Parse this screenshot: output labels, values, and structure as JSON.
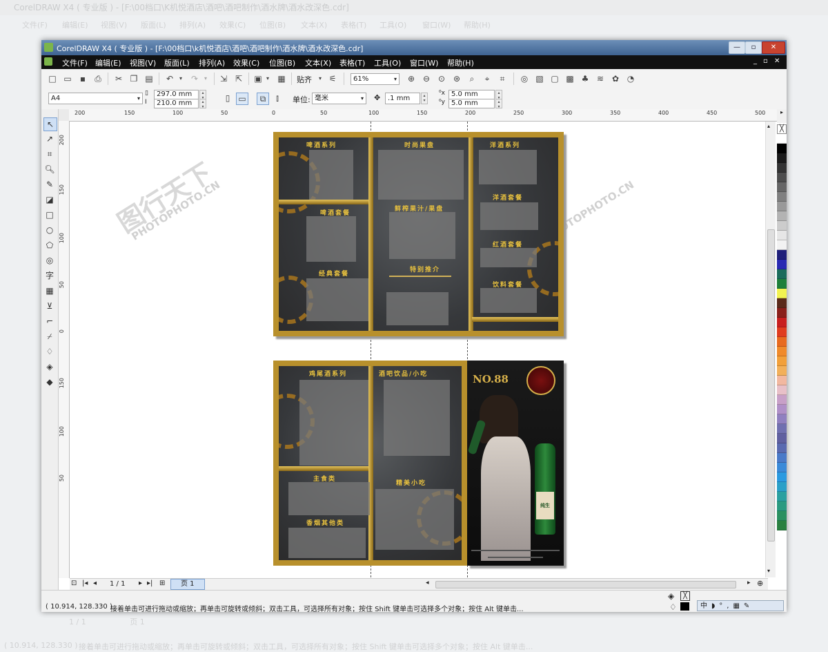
{
  "background": {
    "title": "CorelDRAW X4 ( 专业版 ) - [F:\\00档口\\K机悦酒店\\酒吧\\酒吧制作\\酒水牌\\酒水改深色.cdr]",
    "menus": [
      "文件(F)",
      "编辑(E)",
      "视图(V)",
      "版面(L)",
      "排列(A)",
      "效果(C)",
      "位图(B)",
      "文本(X)",
      "表格(T)",
      "工具(O)",
      "窗口(W)",
      "帮助(H)"
    ],
    "status_coords": "( 10.914, 128.330 )",
    "status_hint": "接着单击可进行拖动或缩放；再单击可旋转或倾斜；双击工具，可选择所有对象；按住 Shift 键单击可选择多个对象；按住 Alt 键单击...",
    "page_nav": "1 / 1",
    "page_tab": "页 1"
  },
  "window": {
    "title": "CorelDRAW X4 ( 专业版 ) - [F:\\00档口\\k机悦酒店\\酒吧\\酒吧制作\\酒水牌\\酒水改深色.cdr]"
  },
  "menubar": {
    "items": [
      "文件(F)",
      "编辑(E)",
      "视图(V)",
      "版面(L)",
      "排列(A)",
      "效果(C)",
      "位图(B)",
      "文本(X)",
      "表格(T)",
      "工具(O)",
      "窗口(W)",
      "帮助(H)"
    ]
  },
  "toolbar": {
    "snap_label": "贴齐",
    "zoom": "61%"
  },
  "propbar": {
    "paper_size": "A4",
    "width": "297.0 mm",
    "height": "210.0 mm",
    "units_label": "单位:",
    "units": "毫米",
    "nudge": ".1 mm",
    "dup_x": "5.0 mm",
    "dup_y": "5.0 mm"
  },
  "ruler_top": [
    "200",
    "150",
    "100",
    "50",
    "0",
    "50",
    "100",
    "150",
    "200",
    "250",
    "300",
    "350",
    "400",
    "450",
    "500"
  ],
  "ruler_left": [
    "200",
    "150",
    "100",
    "50",
    "0",
    "150",
    "100",
    "50"
  ],
  "page_nav": {
    "counter": "1 / 1",
    "tab": "页 1"
  },
  "status": {
    "coords": "( 10.914, 128.330 )",
    "hint": "接着单击可进行拖动或缩放；再单击可旋转或倾斜；双击工具，可选择所有对象；按住 Shift 键单击可选择多个对象；按住 Alt 键单击..."
  },
  "menu_sheet_top": {
    "headings": [
      "啤酒系列",
      "时尚果盘",
      "洋酒系列",
      "啤酒套餐",
      "鲜榨果汁/果盘",
      "洋酒套餐",
      "特别推介",
      "红酒套餐",
      "经典套餐",
      "饮料套餐"
    ]
  },
  "menu_sheet_bottom": {
    "headings": [
      "鸡尾酒系列",
      "酒吧饮品/小吃",
      "主食类",
      "精美小吃",
      "香烟其他类"
    ],
    "brand": "NO.88",
    "beer_label": "纯生"
  },
  "watermark": {
    "main": "图行天下",
    "sub": "PHOTOPHOTO.CN"
  },
  "palette_colors": [
    "#ffffff",
    "#000000",
    "#1a1a1a",
    "#333333",
    "#4d4d4d",
    "#666666",
    "#808080",
    "#999999",
    "#b3b3b3",
    "#cccccc",
    "#e6e6e6",
    "#f2f2f2",
    "#1f1f7a",
    "#2a2ab3",
    "#1a6b5a",
    "#1e7f3a",
    "#f2f251",
    "#5a2a1a",
    "#8a1f1a",
    "#c81e1e",
    "#e03c1e",
    "#e86a1e",
    "#f08a2a",
    "#f2a03a",
    "#f2b05a",
    "#f2b8a0",
    "#e8c0c8",
    "#c8a0c8",
    "#b090c8",
    "#9080c0",
    "#7070b0",
    "#6060a0",
    "#5a6ab0",
    "#4a7ac8",
    "#3a8ad8",
    "#2a9ae0",
    "#2aa0c8",
    "#2aa0a0",
    "#2a9a80",
    "#2a9060",
    "#2a8040"
  ]
}
